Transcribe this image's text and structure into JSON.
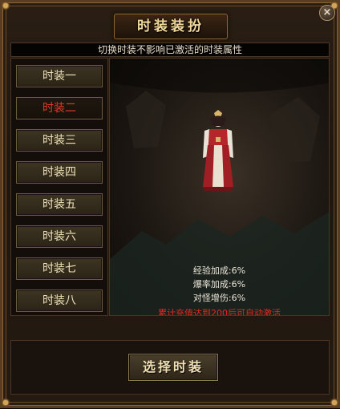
{
  "window": {
    "title": "时装装扮",
    "close_label": "×"
  },
  "hint": "切换时装不影响已激活的时装属性",
  "tabs": [
    {
      "label": "时装一",
      "active": false
    },
    {
      "label": "时装二",
      "active": true
    },
    {
      "label": "时装三",
      "active": false
    },
    {
      "label": "时装四",
      "active": false
    },
    {
      "label": "时装五",
      "active": false
    },
    {
      "label": "时装六",
      "active": false
    },
    {
      "label": "时装七",
      "active": false
    },
    {
      "label": "时装八",
      "active": false
    }
  ],
  "stats": [
    "经验加成:6%",
    "爆率加成:6%",
    "对怪增伤:6%"
  ],
  "note": "累计充值达到200后可自动激活",
  "select_button": "选择时装",
  "colors": {
    "active_tab": "#e23a2a",
    "note": "#e22a1e",
    "title": "#f3d89b"
  }
}
